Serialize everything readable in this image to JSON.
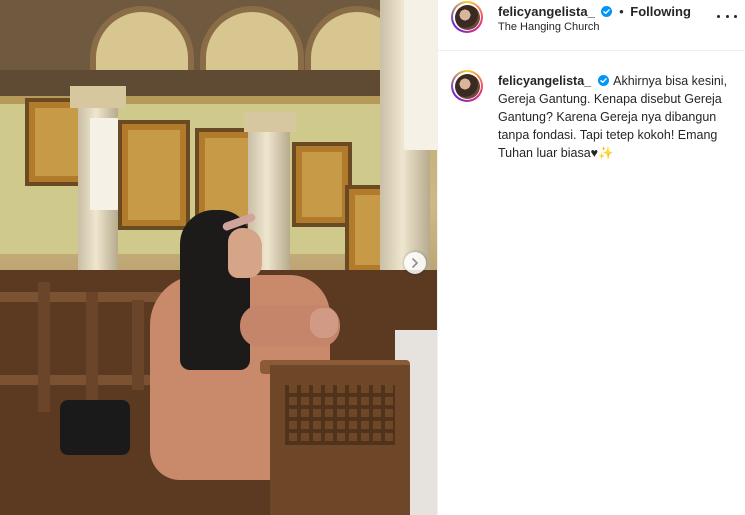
{
  "post": {
    "username": "felicyangelista_",
    "verified": true,
    "follow_status": "Following",
    "separator": "•",
    "location": "The Hanging Church",
    "caption": "Akhirnya bisa kesini, Gereja Gantung. Kenapa disebut Gereja Gantung? Karena Gereja nya dibangun tanpa fondasi. Tapi tetep kokoh! Emang Tuhan luar biasa♥✨"
  },
  "icons": {
    "more": "more-options-icon",
    "verified": "verified-badge-icon",
    "next": "chevron-right-icon"
  },
  "colors": {
    "verified_blue": "#0095f6",
    "text": "#262626",
    "divider": "#efefef"
  }
}
